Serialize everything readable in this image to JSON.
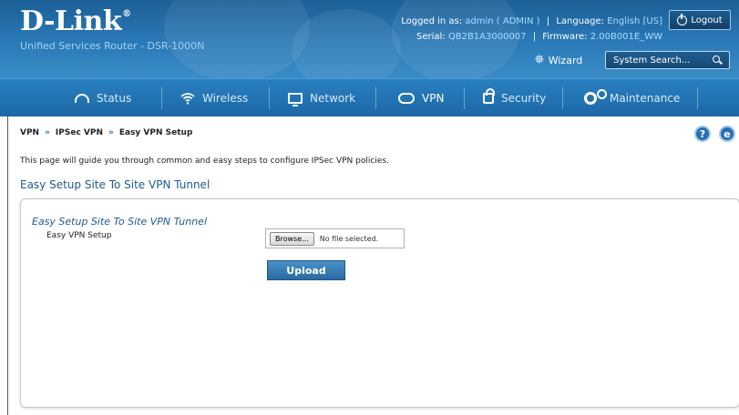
{
  "header": {
    "logo": "D-Link",
    "logo_mark": "®",
    "subtitle": "Unified Services Router - DSR-1000N",
    "logged_in_label": "Logged in as:",
    "logged_in_value": "admin ( ADMIN )",
    "language_label": "Language:",
    "language_value": "English [US]",
    "serial_label": "Serial:",
    "serial_value": "QB2B1A3000007",
    "firmware_label": "Firmware:",
    "firmware_value": "2.00B001E_WW",
    "logout": "Logout",
    "wizard": "Wizard",
    "search_placeholder": "System Search..."
  },
  "nav": {
    "items": [
      {
        "label": "Status",
        "icon": "status-icon"
      },
      {
        "label": "Wireless",
        "icon": "wifi-icon"
      },
      {
        "label": "Network",
        "icon": "network-icon"
      },
      {
        "label": "VPN",
        "icon": "vpn-icon",
        "active": true
      },
      {
        "label": "Security",
        "icon": "lock-icon"
      },
      {
        "label": "Maintenance",
        "icon": "gear-icon"
      }
    ]
  },
  "breadcrumb": [
    "VPN",
    "IPSec VPN",
    "Easy VPN Setup"
  ],
  "breadcrumb_sep": "»",
  "help": {
    "q": "?",
    "alt": "e"
  },
  "description": "This page will guide you through common and easy steps to configure IPSec VPN policies.",
  "section_title": "Easy Setup Site To Site VPN Tunnel",
  "panel": {
    "title": "Easy Setup Site To Site VPN Tunnel",
    "field_label": "Easy VPN Setup",
    "browse": "Browse...",
    "file_status": "No file selected.",
    "upload": "Upload"
  },
  "colors": {
    "header_blue": "#1b5f97",
    "nav_blue": "#1c67a6",
    "title_blue": "#1f5a8e"
  }
}
